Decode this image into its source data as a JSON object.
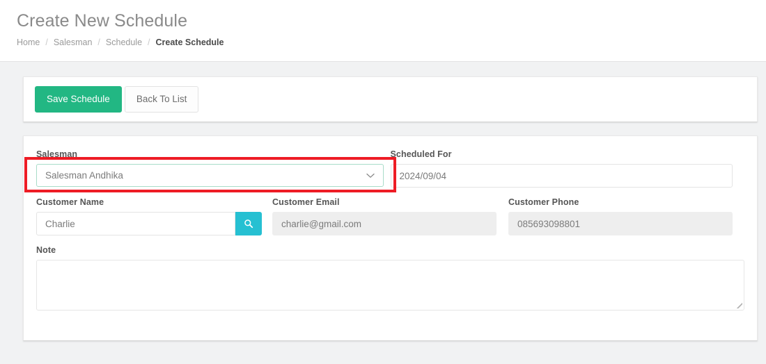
{
  "header": {
    "title": "Create New Schedule",
    "breadcrumb": [
      {
        "label": "Home",
        "active": false
      },
      {
        "label": "Salesman",
        "active": false
      },
      {
        "label": "Schedule",
        "active": false
      },
      {
        "label": "Create Schedule",
        "active": true
      }
    ],
    "separator": "/"
  },
  "toolbar": {
    "save_label": "Save Schedule",
    "back_label": "Back To List"
  },
  "form": {
    "salesman": {
      "label": "Salesman",
      "value": "Salesman Andhika",
      "chevron": "⌄",
      "highlighted": true,
      "highlight_color": "#ee1c25",
      "focus_border_color": "#a8dcc8"
    },
    "scheduled_for": {
      "label": "Scheduled For",
      "value": "2024/09/04"
    },
    "customer_name": {
      "label": "Customer Name",
      "value": "Charlie",
      "search_icon": "search-icon",
      "search_button_color": "#26c0d2"
    },
    "customer_email": {
      "label": "Customer Email",
      "value": "charlie@gmail.com",
      "readonly": true
    },
    "customer_phone": {
      "label": "Customer Phone",
      "value": "085693098801",
      "readonly": true
    },
    "note": {
      "label": "Note",
      "value": "",
      "placeholder": ""
    }
  },
  "colors": {
    "primary_green": "#22b783",
    "accent_teal": "#26c0d2",
    "annotation_red": "#ee1c25",
    "page_background": "#f1f2f3",
    "card_background": "#ffffff"
  }
}
